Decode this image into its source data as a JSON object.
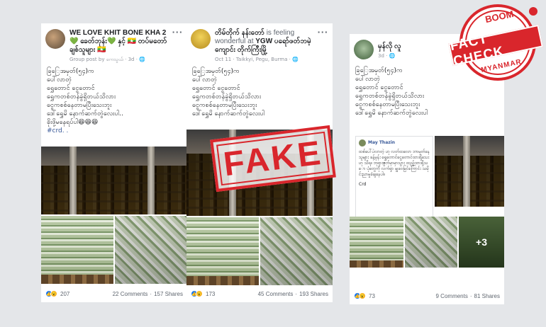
{
  "posts": [
    {
      "author": "WE LOVE KHIT BONE KHA 2 💚 ခေတ်ဘုန်း💚 နှင့် 🇲🇲 တပ်မတော် ချစ်သူများ 🇲🇲",
      "meta": "Group post by ကေသွယ် · 3d · 🌐",
      "lines": [
        "ခြြေအမှတ်(၅၄)က",
        "ပေါ်လာတဲ့",
        "ရွှေတောင် ငွေတောင်",
        "ရွှေကတစ်တန်ခွဲရှိတယ်သိလား",
        "ငွေကစစ်နေတာမပြီးသေးဘူး",
        "ဒေါ်ရွှေမိ နောက်ဆက်တွဲလေးပါ..",
        "ခိုးဖို့မနေရပ်ပါ😆😆😆"
      ],
      "tag": "#crd. .",
      "likes": "207",
      "comments": "22 Comments",
      "shares": "157 Shares"
    },
    {
      "author": "တိမ်တိုက် နန်းတော်",
      "author_rest": " is feeling wonderful at ",
      "place": "YGW ပရော်ဖတ်ဘမဲ့ ကျောင်း တိုက်ကြီးမြို့",
      "meta": "Oct 11 · Taikkyi, Pegu, Burma · 🌐",
      "lines": [
        "ခြြေအမှတ်(၅၄)က",
        "ပေါ်လာတဲ့",
        "ရွှေတောင် ငွေတောင်",
        "ရွှေကတစ်တန်ခွဲရှိတယ်သိလား",
        "ငွေကစစ်နေတာမပြီးသေးဘူး",
        "ဒေါ်ရွှေမိ နောက်ဆက်တွဲလေးပါ"
      ],
      "likes": "173",
      "comments": "45 Comments",
      "shares": "193 Shares"
    },
    {
      "author": "မှန်လို လူ",
      "meta": "3d · 🌐",
      "lines": [
        "ခြြေအမှတ်(၅၄)က",
        "ပေါ်လာတဲ့",
        "ရွှေတောင် ငွေတောင်",
        "ရွှေကတစ်တန်ခွဲရှိတယ်သိလား",
        "ငွေကစစ်နေတာမပြီးသေးဘူး",
        "ဒေါ်ရွှေမိ နောက်ဆက်တွဲလေးပါ"
      ],
      "inner_author": "May Thazin",
      "inner_text": "ထစ်ပေါ်ပဲလာတဲ့ ဟု လတ်ထလော ဘာမှတ်နေသူများ ခန့်မှန်း ရွှေတောင်ငွေတောင်ထားရှိသေး ဟု သိရ။ ဘုရားဇွတ်မှာမှာသွား ထည့်ထားရှိသော ပုံတွေကို လက်ရှာ မျှဝေမြင်ကြောင်း သမိုင်းညာမှုခံချနေပါ။",
      "inner_tag": "Crd",
      "more": "+3",
      "likes": "73",
      "comments": "9 Comments",
      "shares": "81 Shares"
    }
  ],
  "stamp": {
    "label": "FAKE",
    "color": "#d9262c"
  },
  "badge": {
    "top": "BOOM",
    "main": "FACT CHECK",
    "bottom": "MYANMAR",
    "color": "#d9262c"
  }
}
